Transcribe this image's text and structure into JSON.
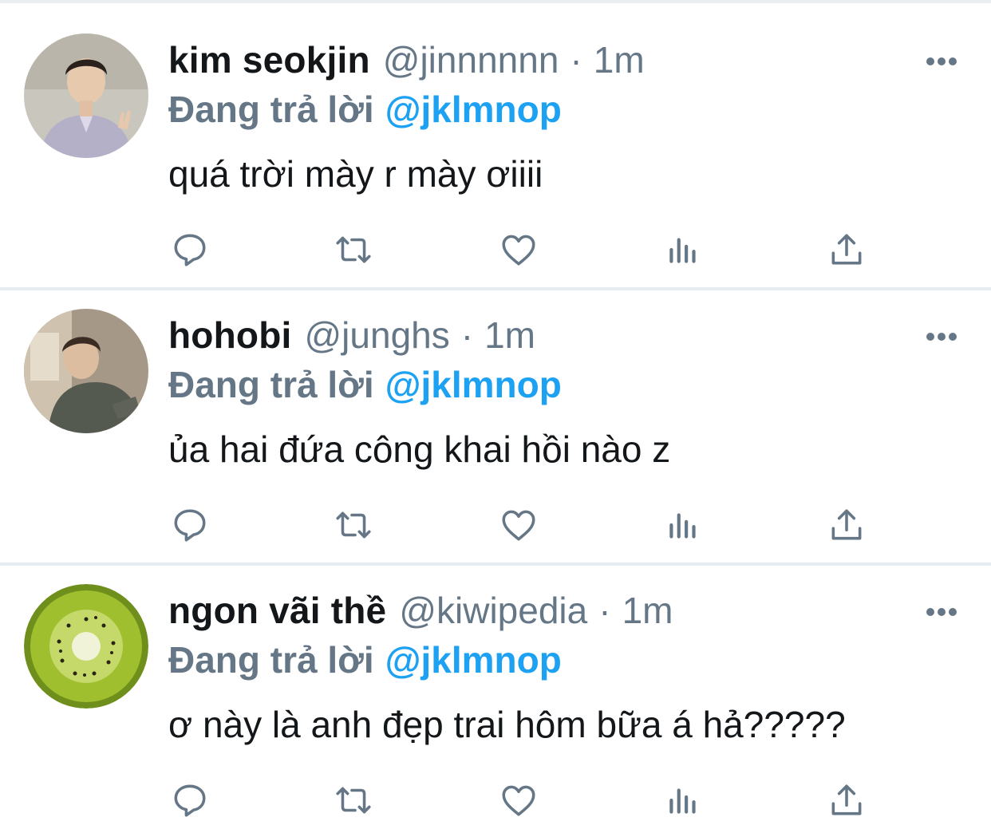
{
  "colors": {
    "name": "#14171a",
    "secondary": "#657786",
    "accent": "#1da1f2",
    "separator": "#e6ecf0"
  },
  "icons": [
    "reply-icon",
    "retweet-icon",
    "like-icon",
    "analytics-icon",
    "share-icon",
    "more-icon"
  ],
  "tweets": [
    {
      "display_name": "kim seokjin",
      "handle": "@jinnnnnn",
      "separator": "·",
      "time": "1m",
      "reply_prefix": "Đang trả lời",
      "reply_to": "@jklmnop",
      "text": "quá trời mày r mày ơiiii",
      "avatar": "person-photo"
    },
    {
      "display_name": "hohobi",
      "handle": "@junghs",
      "separator": "·",
      "time": "1m",
      "reply_prefix": "Đang trả lời",
      "reply_to": "@jklmnop",
      "text": "ủa hai đứa công khai hồi nào z",
      "avatar": "person-photo"
    },
    {
      "display_name": "ngon vãi thề",
      "handle": "@kiwipedia",
      "separator": "·",
      "time": "1m",
      "reply_prefix": "Đang trả lời",
      "reply_to": "@jklmnop",
      "text": "ơ này là anh đẹp trai hôm bữa á hả?????",
      "avatar": "kiwi-photo"
    }
  ]
}
